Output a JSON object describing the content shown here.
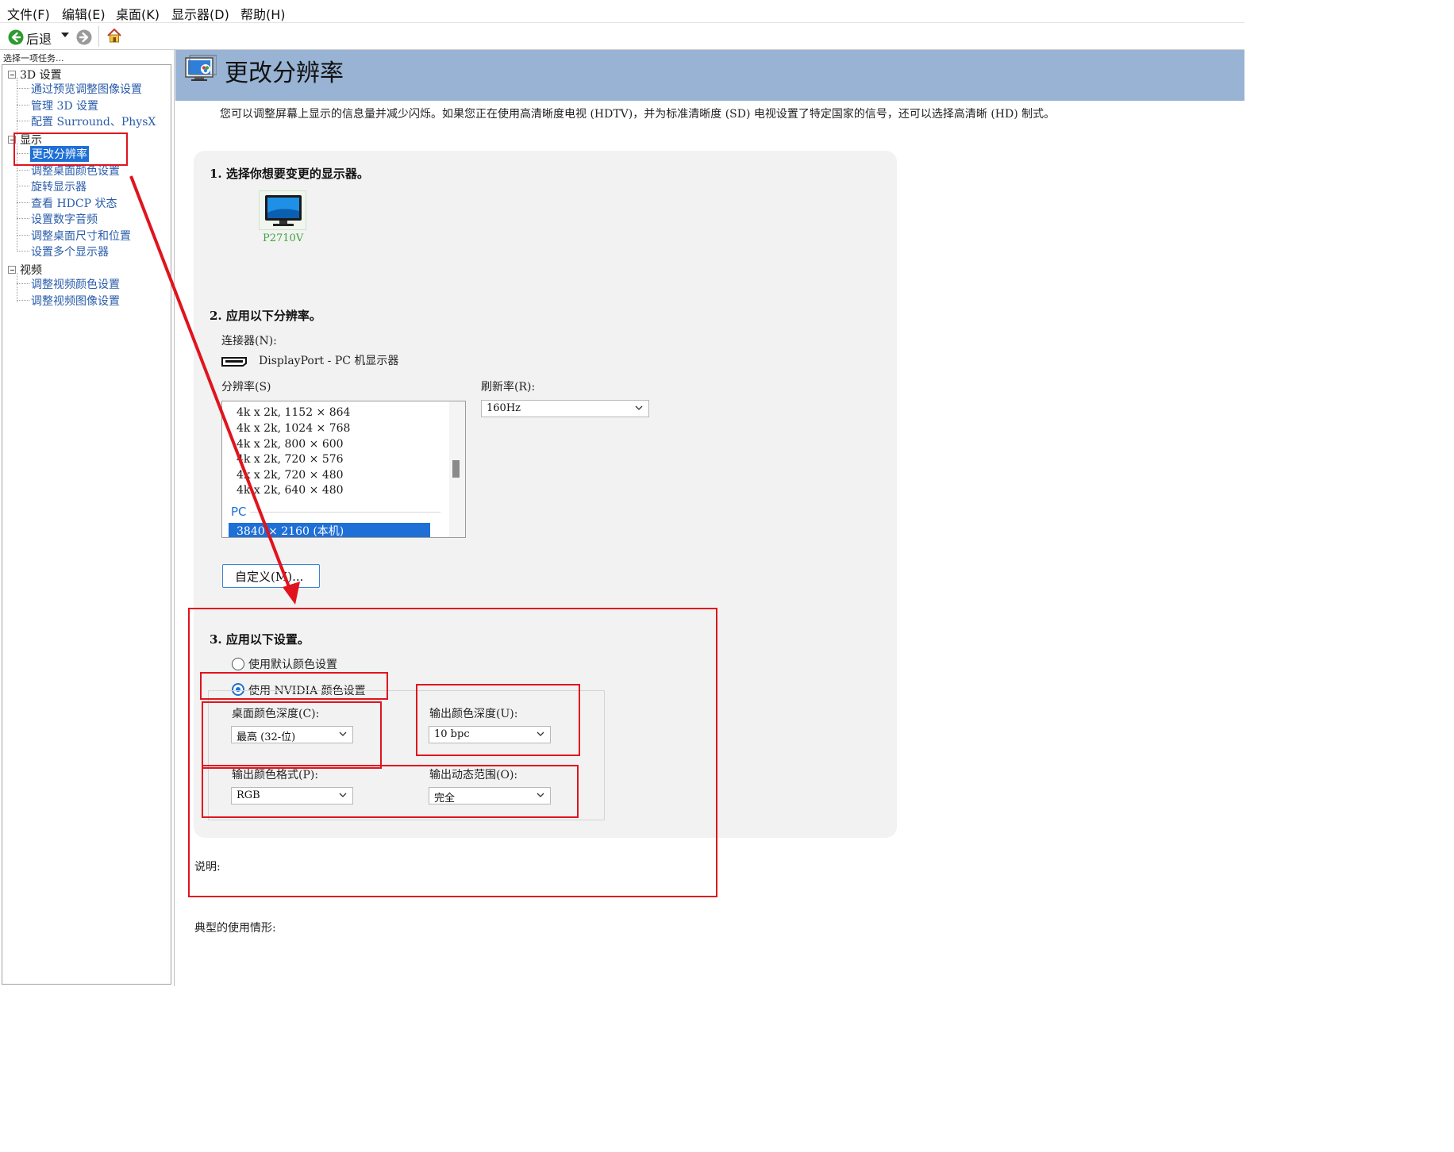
{
  "menubar": {
    "items": [
      "文件(F)",
      "编辑(E)",
      "桌面(K)",
      "显示器(D)",
      "帮助(H)"
    ]
  },
  "toolbar": {
    "back_label": "后退",
    "icons": [
      "back-arrow-icon",
      "dropdown-caret-icon",
      "forward-arrow-icon",
      "home-icon"
    ]
  },
  "sidebar": {
    "caption": "选择一项任务...",
    "categories": [
      {
        "label": "3D 设置",
        "items": [
          "通过预览调整图像设置",
          "管理 3D 设置",
          "配置 Surround、PhysX"
        ]
      },
      {
        "label": "显示",
        "items": [
          "更改分辨率",
          "调整桌面颜色设置",
          "旋转显示器",
          "查看 HDCP 状态",
          "设置数字音频",
          "调整桌面尺寸和位置",
          "设置多个显示器"
        ]
      },
      {
        "label": "视频",
        "items": [
          "调整视频颜色设置",
          "调整视频图像设置"
        ]
      }
    ],
    "selected_item": "更改分辨率"
  },
  "header": {
    "title": "更改分辨率",
    "icon": "display-settings-icon"
  },
  "description": "您可以调整屏幕上显示的信息量并减少闪烁。如果您正在使用高清晰度电视 (HDTV)，并为标准清晰度 (SD) 电视设置了特定国家的信号，还可以选择高清晰 (HD) 制式。",
  "step1": {
    "title": "1. 选择你想要变更的显示器。",
    "monitor_name": "P2710V"
  },
  "step2": {
    "title": "2. 应用以下分辨率。",
    "connector_label": "连接器(N):",
    "connector_value": "DisplayPort - PC 机显示器",
    "resolution_label": "分辨率(S)",
    "refresh_label": "刷新率(R):",
    "refresh_value": "160Hz",
    "resolutions": [
      "4k x 2k, 1152 × 864",
      "4k x 2k, 1024 × 768",
      "4k x 2k, 800 × 600",
      "4k x 2k, 720 × 576",
      "4k x 2k, 720 × 480",
      "4k x 2k, 640 × 480"
    ],
    "group_label": "PC",
    "selected_resolution": "3840 × 2160 (本机)",
    "custom_button": "自定义(M)..."
  },
  "step3": {
    "title": "3. 应用以下设置。",
    "radio_default": "使用默认颜色设置",
    "radio_nvidia": "使用 NVIDIA 颜色设置",
    "radio_selected": "使用 NVIDIA 颜色设置",
    "desktop_depth_label": "桌面颜色深度(C):",
    "desktop_depth_value": "最高 (32-位)",
    "output_depth_label": "输出颜色深度(U):",
    "output_depth_value": "10 bpc",
    "output_format_label": "输出颜色格式(P):",
    "output_format_value": "RGB",
    "output_range_label": "输出动态范围(O):",
    "output_range_value": "完全"
  },
  "footer": {
    "explanation_label": "说明:",
    "typical_usage_label": "典型的使用情形:"
  },
  "colors": {
    "header_bg": "#98b3d3",
    "selection_blue": "#1e6fd6",
    "link_blue": "#2a5caa",
    "annotation_red": "#e0141e",
    "monitor_label_green": "#3aa63a"
  }
}
